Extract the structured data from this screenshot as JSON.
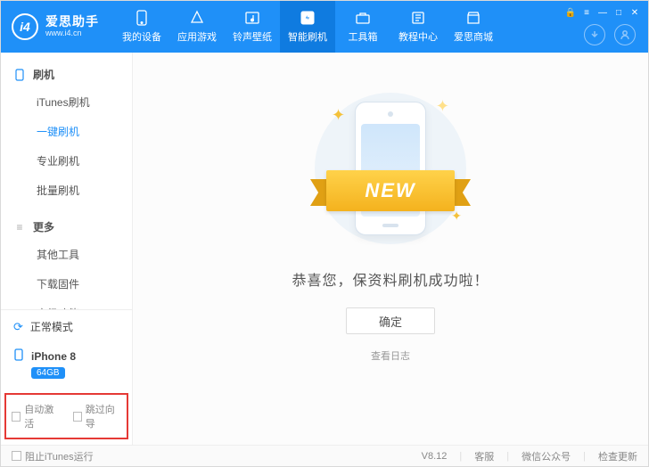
{
  "header": {
    "logo_text": "爱思助手",
    "logo_url": "www.i4.cn",
    "nav": [
      {
        "label": "我的设备",
        "icon": "phone"
      },
      {
        "label": "应用游戏",
        "icon": "apps"
      },
      {
        "label": "铃声壁纸",
        "icon": "music"
      },
      {
        "label": "智能刷机",
        "icon": "flash",
        "active": true
      },
      {
        "label": "工具箱",
        "icon": "toolbox"
      },
      {
        "label": "教程中心",
        "icon": "book"
      },
      {
        "label": "爱思商城",
        "icon": "shop"
      }
    ]
  },
  "sidebar": {
    "section1_title": "刷机",
    "items1": [
      {
        "label": "iTunes刷机"
      },
      {
        "label": "一键刷机",
        "active": true
      },
      {
        "label": "专业刷机"
      },
      {
        "label": "批量刷机"
      }
    ],
    "section2_title": "更多",
    "items2": [
      {
        "label": "其他工具"
      },
      {
        "label": "下载固件"
      },
      {
        "label": "高级功能"
      }
    ],
    "mode_label": "正常模式",
    "device_name": "iPhone 8",
    "device_storage": "64GB",
    "auto_activate_label": "自动激活",
    "skip_wizard_label": "跳过向导"
  },
  "content": {
    "ribbon_text": "NEW",
    "success_message": "恭喜您，保资料刷机成功啦！",
    "ok_button": "确定",
    "view_log": "查看日志"
  },
  "footer": {
    "block_itunes_label": "阻止iTunes运行",
    "version": "V8.12",
    "support": "客服",
    "wechat": "微信公众号",
    "check_update": "检查更新"
  }
}
